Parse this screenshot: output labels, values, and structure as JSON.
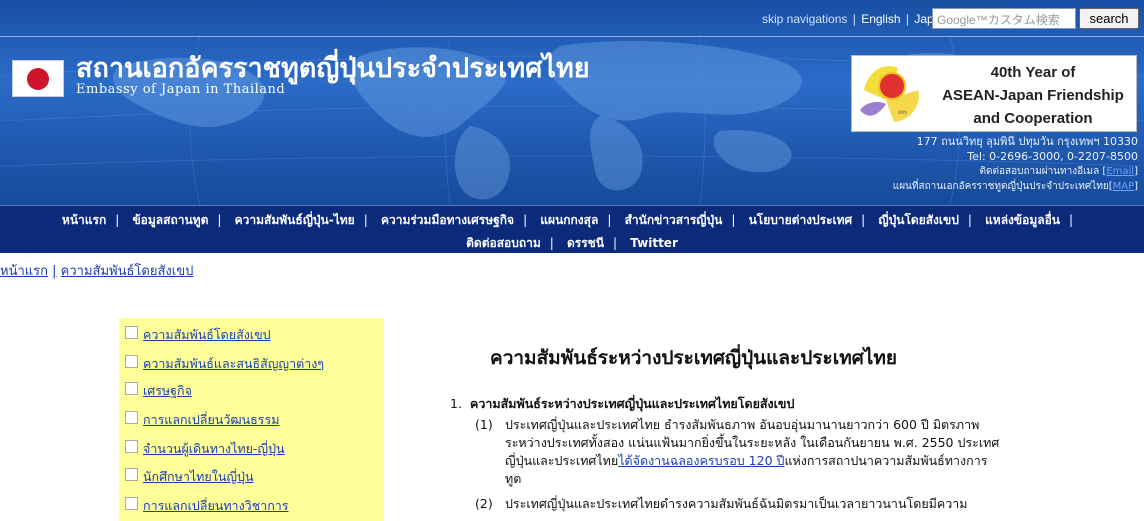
{
  "topnav": {
    "skip": "skip navigations",
    "sep": "|",
    "english": "English",
    "japanese": "Japanese",
    "search_placeholder": "Google™カスタム検索",
    "search_button": "search"
  },
  "header": {
    "title_th": "สถานเอกอัครราชทูตญี่ปุ่นประจำประเทศไทย",
    "title_en": "Embassy of Japan in Thailand",
    "banner_text": [
      "40th Year of",
      "ASEAN-Japan Friendship",
      "and Cooperation"
    ],
    "address_lines": [
      "177 ถนนวิทยุ ลุมพินี ปทุมวัน กรุงเทพฯ 10330",
      "Tel: 0-2696-3000, 0-2207-8500"
    ],
    "contact_email": "ติดต่อสอบถามผ่านทางอีเมล [",
    "contact_email_link": "Email",
    "contact_email_end": "]",
    "map_text": "แผนที่สถานเอกอัครราชทูตญี่ปุ่นประจำประเทศไทย[",
    "map_link": "MAP",
    "map_end": "]"
  },
  "mainnav": {
    "row1": [
      "หน้าแรก",
      "ข้อมูลสถานทูต",
      "ความสัมพันธ์ญี่ปุ่น-ไทย",
      "ความร่วมมือทางเศรษฐกิจ",
      "แผนกกงสุล",
      "สำนักข่าวสารญี่ปุ่น",
      "นโยบายต่างประเทศ",
      "ญี่ปุ่นโดยสังเขป",
      "แหล่งข้อมูลอื่น"
    ],
    "row2": [
      "ติดต่อสอบถาม",
      "ดรรชนี",
      "Twitter"
    ]
  },
  "breadcrumb": {
    "home": "หน้าแรก",
    "sep": "|",
    "current": "ความสัมพันธ์โดยสังเขป"
  },
  "sidemenu": {
    "items": [
      "ความสัมพันธ์โดยสังเขป",
      "ความสัมพันธ์และสนธิสัญญาต่างๆ",
      "เศรษฐกิจ",
      "การแลกเปลี่ยนวัฒนธรรม",
      "จำนวนผู้เดินทางไทย-ญี่ปุ่น",
      "นักศึกษาไทยในญี่ปุ่น",
      "การแลกเปลี่ยนทางวิชาการ"
    ]
  },
  "content": {
    "title": "ความสัมพันธ์ระหว่างประเทศญี่ปุ่นและประเทศไทย",
    "section1_num": "1.",
    "section1_title": "ความสัมพันธ์ระหว่างประเทศญี่ปุ่นและประเทศไทยโดยสังเขป",
    "p1_num": "(1)",
    "p1_lines": [
      "ประเทศญี่ปุ่นและประเทศไทย ธำรงสัมพันธภาพ อันอบอุ่นมานานยาวกว่า 600 ปี มิตรภาพ",
      "ระหว่างประเทศทั้งสอง แน่นแฟ้นมากยิ่งขึ้นในระยะหลัง ในเดือนกันยายน พ.ศ. 2550 ประเทศ"
    ],
    "p1_line3_pre": "ญี่ปุ่นและประเทศไทย",
    "p1_line3_link": "ได้จัดงานฉลองครบรอบ 120 ปี",
    "p1_line3_post": "แห่งการสถาปนาความสัมพันธ์ทางการ",
    "p1_line4": "ทูต",
    "p2_num": "(2)",
    "p2_line1": "ประเทศญี่ปุ่นและประเทศไทยดำรงความสัมพันธ์ฉันมิตรมาเป็นเวลายาวนานโดยมีความ"
  },
  "colors": {
    "header_blue": "#1f5ab0",
    "nav_navy": "#0b2a7a",
    "sidemenu_yellow": "#ffff99",
    "link_blue": "#1a3fb0",
    "flag_red": "#d0142c"
  }
}
